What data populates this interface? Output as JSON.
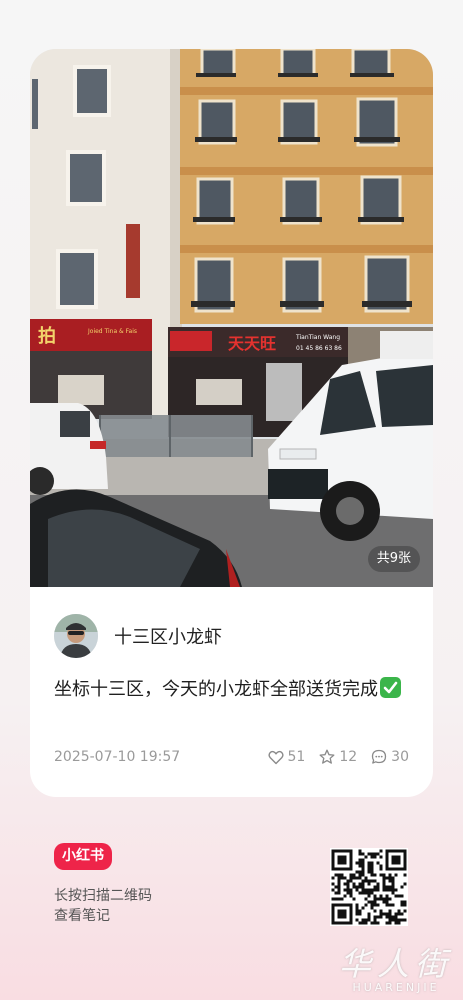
{
  "post": {
    "image_count_label": "共9张",
    "author_name": "十三区小龙虾",
    "text": "坐标十三区，今天的小龙虾全部送货完成",
    "date": "2025-07-10 19:57",
    "likes": "51",
    "favorites": "12",
    "comments": "30"
  },
  "photo_signs": {
    "left_sign": "拍",
    "left_sign_small": "Joied Tina & Fais",
    "main_sign": "天天旺",
    "main_sign_en": "TianTian Wang",
    "main_sign_phone": "01 45 86 63 86"
  },
  "footer": {
    "brand_label": "小红书",
    "hint_line1": "长按扫描二维码",
    "hint_line2": "查看笔记"
  },
  "watermark": {
    "chinese": "华人街",
    "latin": "HUARENJIE"
  },
  "colors": {
    "brand": "#ee2449",
    "check_green": "#3bb54a",
    "muted_text": "#9a9a9a"
  },
  "icons": {
    "like": "heart-outline-icon",
    "favorite": "star-outline-icon",
    "comment": "chat-bubble-icon",
    "done": "check-mark-icon"
  }
}
